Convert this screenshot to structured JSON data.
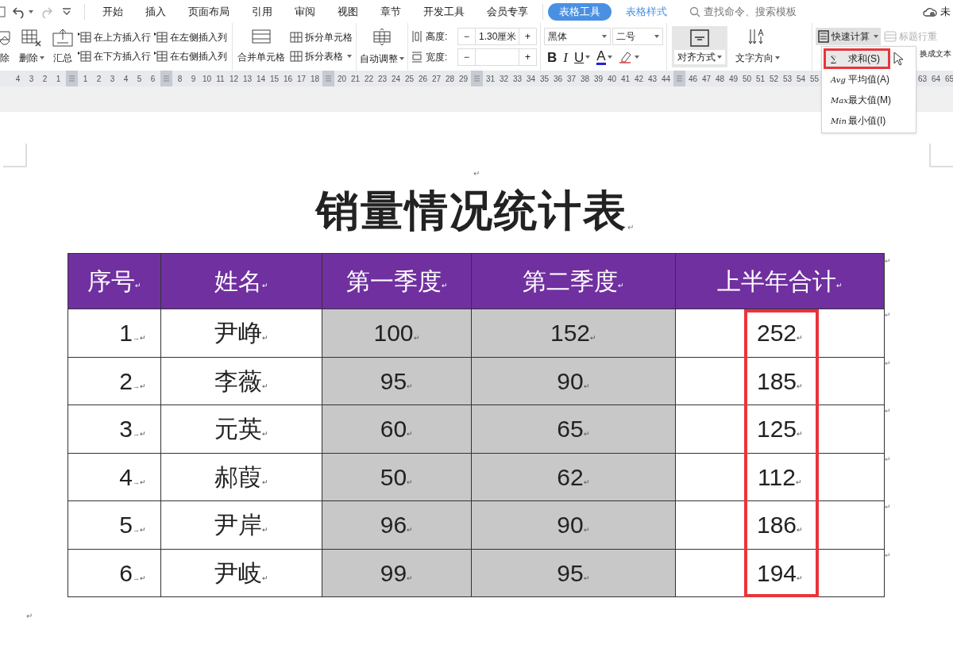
{
  "tabs": [
    {
      "label": "开始",
      "selected": false
    },
    {
      "label": "插入",
      "selected": false
    },
    {
      "label": "页面布局",
      "selected": false
    },
    {
      "label": "引用",
      "selected": false
    },
    {
      "label": "审阅",
      "selected": false
    },
    {
      "label": "视图",
      "selected": false
    },
    {
      "label": "章节",
      "selected": false
    },
    {
      "label": "开发工具",
      "selected": false
    },
    {
      "label": "会员专享",
      "selected": false
    }
  ],
  "context_tabs": [
    {
      "label": "表格工具",
      "selected": true
    },
    {
      "label": "表格样式",
      "selected": false
    }
  ],
  "search": {
    "placeholder": "查找命令、搜索模板"
  },
  "sync_status": "未",
  "ribbon": {
    "delete_buttons": [
      {
        "label": "除",
        "caret": false
      },
      {
        "label": "删除",
        "caret": true
      },
      {
        "label": "汇总",
        "caret": false
      }
    ],
    "insert_buttons": [
      {
        "label": "在上方插入行"
      },
      {
        "label": "在下方插入行"
      },
      {
        "label": "在左侧插入列"
      },
      {
        "label": "在右侧插入列"
      }
    ],
    "merge": {
      "label": "合并单元格"
    },
    "split_buttons": [
      {
        "label": "拆分单元格",
        "caret": false
      },
      {
        "label": "拆分表格",
        "caret": true
      }
    ],
    "autofit": {
      "label": "自动调整"
    },
    "height": {
      "label": "高度:",
      "minus": "−",
      "value": "1.30厘米",
      "plus": "+"
    },
    "width": {
      "label": "宽度:",
      "minus": "−",
      "plus": "+"
    },
    "font_name": "黑体",
    "font_size": "二号",
    "format_buttons": [
      {
        "kind": "bold",
        "label": "B"
      },
      {
        "kind": "italic",
        "label": "I"
      },
      {
        "kind": "underline",
        "label": "U"
      },
      {
        "kind": "color",
        "label": "A"
      },
      {
        "kind": "highlight"
      }
    ],
    "align": {
      "label": "对齐方式"
    },
    "direction": {
      "label": "文字方向"
    },
    "quick_calc": {
      "label": "快速计算",
      "expanded": true
    },
    "repeat_header": {
      "label": "标题行重",
      "disabled": true
    },
    "to_text": {
      "label": "换成文本"
    }
  },
  "quick_calc_menu": [
    {
      "icon": "∑",
      "label": "求和(S)",
      "selected": true
    },
    {
      "icon": "Avg",
      "label": "平均值(A)",
      "selected": false
    },
    {
      "icon": "Max",
      "label": "最大值(M)",
      "selected": false
    },
    {
      "icon": "Min",
      "label": "最小值(I)",
      "selected": false
    }
  ],
  "ruler": [
    {
      "kind": "num",
      "text": "4"
    },
    {
      "kind": "num",
      "text": "3"
    },
    {
      "kind": "num",
      "text": "2"
    },
    {
      "kind": "num",
      "text": "1"
    },
    {
      "kind": "marker"
    },
    {
      "kind": "num",
      "text": "1"
    },
    {
      "kind": "num",
      "text": "2"
    },
    {
      "kind": "num",
      "text": "3"
    },
    {
      "kind": "num",
      "text": "4"
    },
    {
      "kind": "num",
      "text": "5"
    },
    {
      "kind": "num",
      "text": "6"
    },
    {
      "kind": "marker"
    },
    {
      "kind": "num",
      "text": "8"
    },
    {
      "kind": "num",
      "text": "9"
    },
    {
      "kind": "num",
      "text": "10"
    },
    {
      "kind": "num",
      "text": "11"
    },
    {
      "kind": "num",
      "text": "12"
    },
    {
      "kind": "num",
      "text": "13"
    },
    {
      "kind": "num",
      "text": "14"
    },
    {
      "kind": "num",
      "text": "15"
    },
    {
      "kind": "num",
      "text": "16"
    },
    {
      "kind": "num",
      "text": "17"
    },
    {
      "kind": "num",
      "text": "18"
    },
    {
      "kind": "marker"
    },
    {
      "kind": "num",
      "text": "20"
    },
    {
      "kind": "num",
      "text": "21"
    },
    {
      "kind": "num",
      "text": "22"
    },
    {
      "kind": "num",
      "text": "23"
    },
    {
      "kind": "num",
      "text": "24"
    },
    {
      "kind": "num",
      "text": "25"
    },
    {
      "kind": "num",
      "text": "26"
    },
    {
      "kind": "num",
      "text": "27"
    },
    {
      "kind": "num",
      "text": "28"
    },
    {
      "kind": "num",
      "text": "29"
    },
    {
      "kind": "marker"
    },
    {
      "kind": "num",
      "text": "31"
    },
    {
      "kind": "num",
      "text": "32"
    },
    {
      "kind": "num",
      "text": "33"
    },
    {
      "kind": "num",
      "text": "34"
    },
    {
      "kind": "num",
      "text": "35"
    },
    {
      "kind": "num",
      "text": "36"
    },
    {
      "kind": "num",
      "text": "37"
    },
    {
      "kind": "num",
      "text": "38"
    },
    {
      "kind": "num",
      "text": "39"
    },
    {
      "kind": "num",
      "text": "40"
    },
    {
      "kind": "num",
      "text": "41"
    },
    {
      "kind": "num",
      "text": "42"
    },
    {
      "kind": "num",
      "text": "43"
    },
    {
      "kind": "num",
      "text": "44"
    },
    {
      "kind": "marker"
    },
    {
      "kind": "num",
      "text": "46"
    },
    {
      "kind": "num",
      "text": "47"
    },
    {
      "kind": "num",
      "text": "48"
    },
    {
      "kind": "num",
      "text": "49"
    },
    {
      "kind": "num",
      "text": "50"
    },
    {
      "kind": "num",
      "text": "51"
    },
    {
      "kind": "num",
      "text": "52"
    },
    {
      "kind": "num",
      "text": "53"
    },
    {
      "kind": "num",
      "text": "54"
    },
    {
      "kind": "num",
      "text": "55"
    },
    {
      "kind": "gap"
    },
    {
      "kind": "num",
      "text": "63"
    },
    {
      "kind": "num",
      "text": "64"
    },
    {
      "kind": "num",
      "text": "65"
    }
  ],
  "document": {
    "top_mark": "↵",
    "title": "销量情况统计表",
    "title_mark": "↵",
    "end_mark": "↵",
    "table": {
      "columns": [
        {
          "header": "序号",
          "header_mark": "↵",
          "shaded": false,
          "cells": [
            {
              "text": "1",
              "mark": "→↵"
            },
            {
              "text": "2",
              "mark": "→↵"
            },
            {
              "text": "3",
              "mark": "→↵"
            },
            {
              "text": "4",
              "mark": "→↵"
            },
            {
              "text": "5",
              "mark": "→↵"
            },
            {
              "text": "6",
              "mark": "→↵"
            }
          ]
        },
        {
          "header": "姓名",
          "header_mark": "↵",
          "shaded": false,
          "cells": [
            {
              "text": "尹峥",
              "mark": "↵"
            },
            {
              "text": "李薇",
              "mark": "↵"
            },
            {
              "text": "元英",
              "mark": "↵"
            },
            {
              "text": "郝葭",
              "mark": "↵"
            },
            {
              "text": "尹岸",
              "mark": "↵"
            },
            {
              "text": "尹岐",
              "mark": "↵"
            }
          ]
        },
        {
          "header": "第一季度",
          "header_mark": "↵",
          "shaded": true,
          "cells": [
            {
              "text": "100",
              "mark": "↵"
            },
            {
              "text": "95",
              "mark": "↵"
            },
            {
              "text": "60",
              "mark": "↵"
            },
            {
              "text": "50",
              "mark": "↵"
            },
            {
              "text": "96",
              "mark": "↵"
            },
            {
              "text": "99",
              "mark": "↵"
            }
          ]
        },
        {
          "header": "第二季度",
          "header_mark": "↵",
          "shaded": true,
          "cells": [
            {
              "text": "152",
              "mark": "↵"
            },
            {
              "text": "90",
              "mark": "↵"
            },
            {
              "text": "65",
              "mark": "↵"
            },
            {
              "text": "62",
              "mark": "↵"
            },
            {
              "text": "90",
              "mark": "↵"
            },
            {
              "text": "95",
              "mark": "↵"
            }
          ]
        },
        {
          "header": "上半年合计",
          "header_mark": "↵",
          "shaded": false,
          "framed": true,
          "cells": [
            {
              "text": "252",
              "mark": "↵"
            },
            {
              "text": "185",
              "mark": "↵"
            },
            {
              "text": "125",
              "mark": "↵"
            },
            {
              "text": "112",
              "mark": "↵"
            },
            {
              "text": "186",
              "mark": "↵"
            },
            {
              "text": "194",
              "mark": "↵"
            }
          ]
        }
      ],
      "row_marks": [
        "↵",
        "↵",
        "↵",
        "↵",
        "↵",
        "↵",
        "↵"
      ]
    }
  }
}
